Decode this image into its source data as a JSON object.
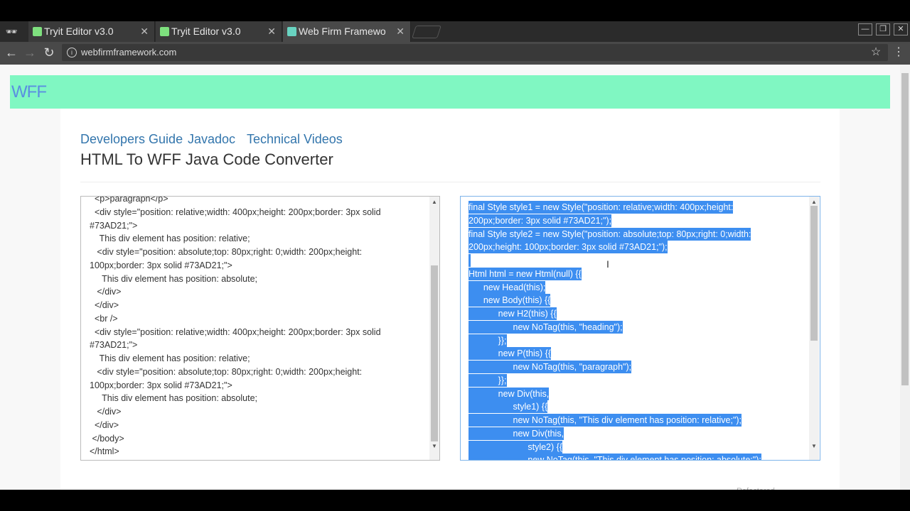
{
  "browser": {
    "tabs": [
      {
        "title": "Tryit Editor v3.0",
        "active": false
      },
      {
        "title": "Tryit Editor v3.0",
        "active": false
      },
      {
        "title": "Web Firm Framewo",
        "active": true
      }
    ],
    "url": "webfirmframework.com"
  },
  "site": {
    "logo": "WFF",
    "nav": [
      "Developers Guide",
      "Javadoc",
      "Technical Videos"
    ],
    "title": "HTML To WFF Java Code Converter"
  },
  "editor_left": {
    "lines": [
      "  <p>paragraph</p>",
      "  <div style=\"position: relative;width: 400px;height: 200px;border: 3px solid",
      "#73AD21;\">",
      "    This div element has position: relative;",
      "   <div style=\"position: absolute;top: 80px;right: 0;width: 200px;height:",
      "100px;border: 3px solid #73AD21;\">",
      "     This div element has position: absolute;",
      "   </div>",
      "  </div>",
      "  <br />",
      "  <div style=\"position: relative;width: 400px;height: 200px;border: 3px solid",
      "#73AD21;\">",
      "    This div element has position: relative;",
      "   <div style=\"position: absolute;top: 80px;right: 0;width: 200px;height:",
      "100px;border: 3px solid #73AD21;\">",
      "     This div element has position: absolute;",
      "   </div>",
      "  </div>",
      " </body>",
      "</html>"
    ]
  },
  "editor_right": {
    "lines": [
      "final Style style1 = new Style(\"position: relative;width: 400px;height:",
      "200px;border: 3px solid #73AD21;\");",
      "final Style style2 = new Style(\"position: absolute;top: 80px;right: 0;width:",
      "200px;height: 100px;border: 3px solid #73AD21;\");",
      "",
      "Html html = new Html(null) {{",
      "      new Head(this);",
      "      new Body(this) {{",
      "            new H2(this) {{",
      "                  new NoTag(this, \"heading\");",
      "            }};",
      "            new P(this) {{",
      "                  new NoTag(this, \"paragraph\");",
      "            }};",
      "            new Div(this,",
      "                  style1) {{",
      "                  new NoTag(this, \"This div element has position: relative;\");",
      "                  new Div(this,",
      "                        style2) {{",
      "                        new NoTag(this, \"This div element has position: absolute;\");"
    ]
  },
  "footer_cut_text": "Refactored (cut)"
}
